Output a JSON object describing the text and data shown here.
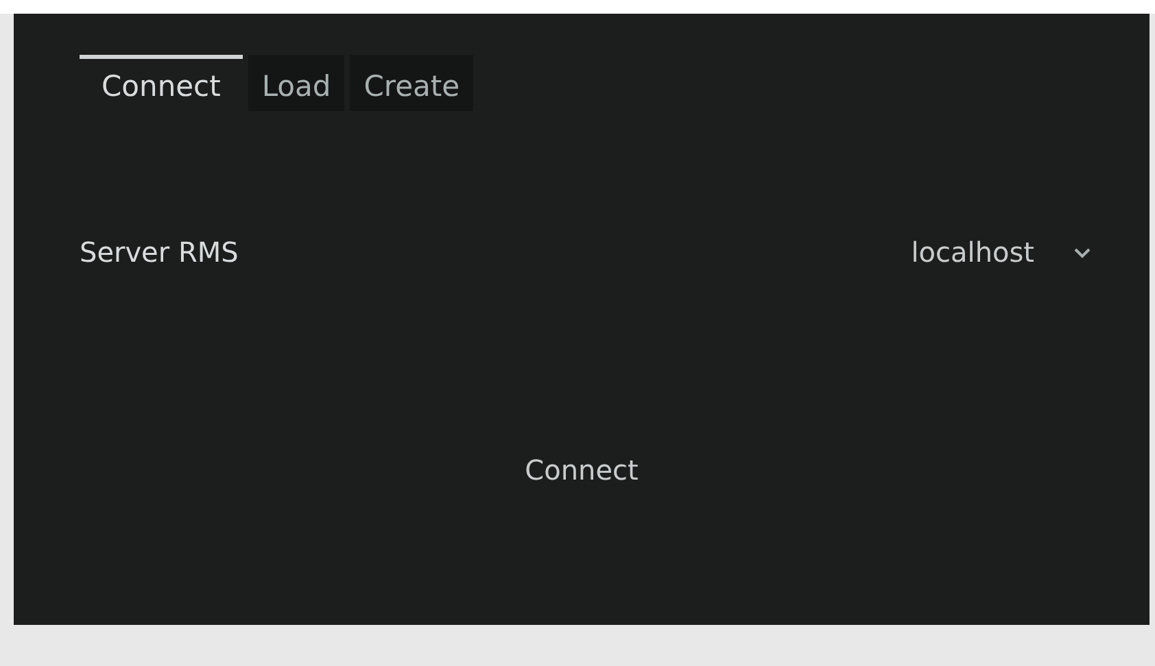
{
  "tabs": [
    {
      "label": "Connect",
      "selected": true
    },
    {
      "label": "Load",
      "selected": false
    },
    {
      "label": "Create",
      "selected": false
    }
  ],
  "server": {
    "label": "Server RMS",
    "value": "localhost"
  },
  "connect_button": "Connect"
}
